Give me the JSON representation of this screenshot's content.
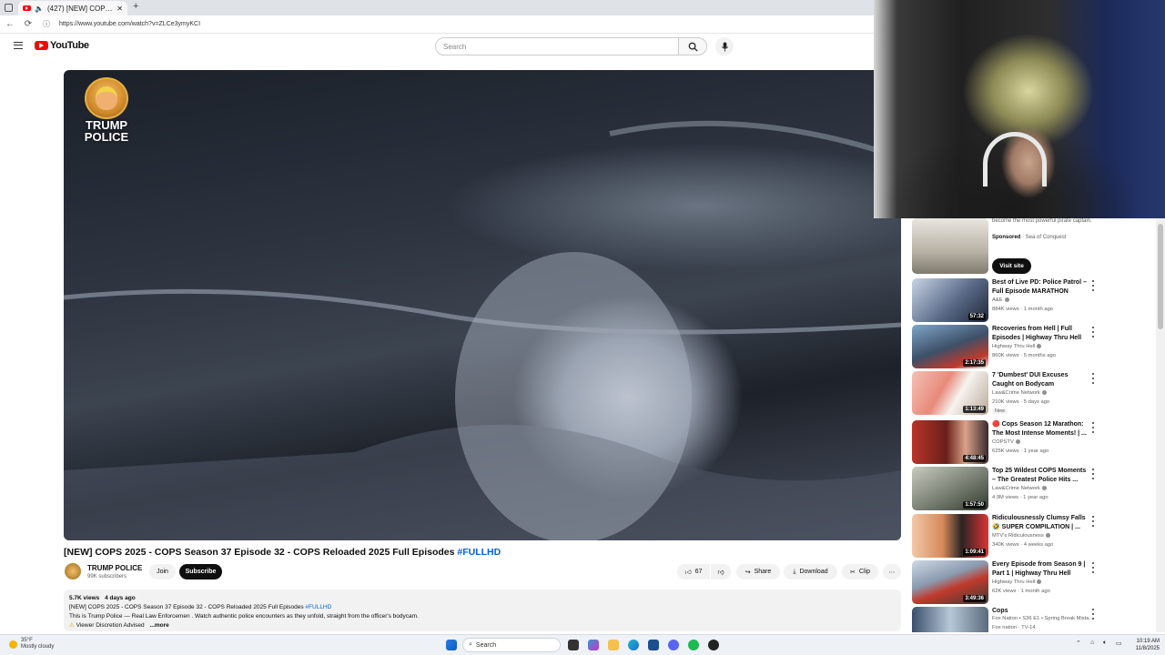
{
  "browser": {
    "tab_title": "(427) [NEW] COPS 2025 - CO",
    "url": "https://www.youtube.com/watch?v=ZLCe3ymyKCI",
    "new_tab_symbol": "+"
  },
  "header": {
    "logo_text": "YouTube",
    "search_placeholder": "Search"
  },
  "video": {
    "overlay_logo_text": "TRUMP POLICE",
    "title": "[NEW] COPS 2025 - COPS Season 37 Episode 32 - COPS Reloaded 2025 Full Episodes",
    "title_tag": "#FULLHD"
  },
  "channel": {
    "name": "TRUMP POLICE",
    "subscribers": "99K subscribers",
    "join_label": "Join",
    "subscribe_label": "Subscribe"
  },
  "actions": {
    "like_count": "67",
    "share_label": "Share",
    "download_label": "Download",
    "clip_label": "Clip"
  },
  "description": {
    "views": "5.7K views",
    "age": "4 days ago",
    "line1": "[NEW] COPS 2025 - COPS Season 37 Episode 32 - COPS Reloaded 2025 Full Episodes",
    "line1_tag": "#FULLHD",
    "line2": "This is Trump Police — Real Law Enforcemen . Watch authentic police encounters as they unfold, straight from the officer's bodycam.",
    "line3": "Viewer Discretion Advised",
    "more_label": "...more"
  },
  "sidebar": {
    "ad": {
      "line1": "become the most powerful pirate captain.",
      "sponsored": "Sponsored",
      "advertiser": "· Sea of Conquest",
      "cta": "Visit site"
    },
    "items": [
      {
        "title": "Best of Live PD: Police Patrol – Full Episode MARATHON (Part...",
        "channel": "A&E",
        "meta": "884K views · 1 month ago",
        "duration": "57:32",
        "badge": ""
      },
      {
        "title": "Recoveries from Hell | Full Episodes | Highway Thru Hell",
        "channel": "Highway Thru Hell",
        "meta": "860K views · 5 months ago",
        "duration": "2:17:35",
        "badge": ""
      },
      {
        "title": "7 'Dumbest' DUI Excuses Caught on Bodycam",
        "channel": "Law&Crime Network",
        "meta": "210K views · 5 days ago",
        "duration": "1:13:49",
        "badge": "New"
      },
      {
        "title": "🔴 Cops Season 12 Marathon: The Most Intense Moments! | ...",
        "channel": "COPSTV",
        "meta": "625K views · 1 year ago",
        "duration": "4:48:45",
        "badge": ""
      },
      {
        "title": "Top 25 Wildest COPS Moments – The Greatest Police Hits ...",
        "channel": "Law&Crime Network",
        "meta": "4.9M views · 1 year ago",
        "duration": "1:57:50",
        "badge": ""
      },
      {
        "title": "Ridiculousnessly Clumsy Falls 🤣 SUPER COMPILATION | ...",
        "channel": "MTV's Ridiculousness",
        "meta": "340K views · 4 weeks ago",
        "duration": "1:09:41",
        "badge": ""
      },
      {
        "title": "Every Episode from Season 9 | Part 1 | Highway Thru Hell",
        "channel": "Highway Thru Hell",
        "meta": "62K views · 1 month ago",
        "duration": "3:49:36",
        "badge": ""
      },
      {
        "title": "Cops",
        "channel": "Fox Nation • S36 E1 • Spring Break Mista...",
        "meta": "Fox nation · TV-14",
        "duration": "",
        "badge": ""
      }
    ]
  },
  "taskbar": {
    "temp": "35°F",
    "weather": "Mostly cloudy",
    "search_label": "Search",
    "time": "10:19 AM",
    "date": "11/8/2025"
  },
  "colors": {
    "accent_red": "#ff0000",
    "link_blue": "#065fd4"
  }
}
